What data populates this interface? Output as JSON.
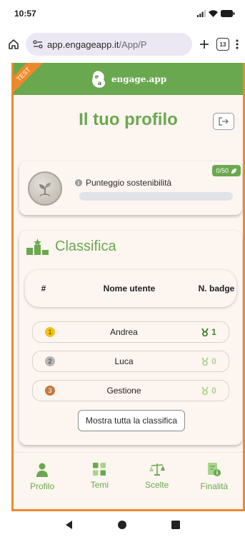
{
  "status_bar": {
    "time": "10:57"
  },
  "browser": {
    "url_host": "app.engageapp.it",
    "url_path": "/App/P",
    "tab_count": "13"
  },
  "app": {
    "ribbon": "TEST",
    "logo_text": "engage.app",
    "page_title": "Il tuo profilo"
  },
  "score": {
    "label": "Punteggio sostenibilità",
    "badge_text": "0/50",
    "progress": 0
  },
  "leaderboard": {
    "title": "Classifica",
    "headers": {
      "rank": "#",
      "name": "Nome utente",
      "badge": "N. badge"
    },
    "rows": [
      {
        "rank": "1",
        "name": "Andrea",
        "badges": "1"
      },
      {
        "rank": "2",
        "name": "Luca",
        "badges": "0"
      },
      {
        "rank": "3",
        "name": "Gestione",
        "badges": "0"
      }
    ],
    "show_all_label": "Mostra tutta la classifica"
  },
  "nav": {
    "items": [
      {
        "label": "Profilo",
        "icon": "person-icon"
      },
      {
        "label": "Temi",
        "icon": "grid-icon"
      },
      {
        "label": "Scelte",
        "icon": "scale-icon"
      },
      {
        "label": "Finalità",
        "icon": "document-info-icon"
      }
    ]
  },
  "colors": {
    "brand_green": "#6aa84f",
    "frame_orange": "#ec8a2b",
    "gold": "#f2c318",
    "silver": "#b5b5b5",
    "bronze": "#c57a3e"
  }
}
